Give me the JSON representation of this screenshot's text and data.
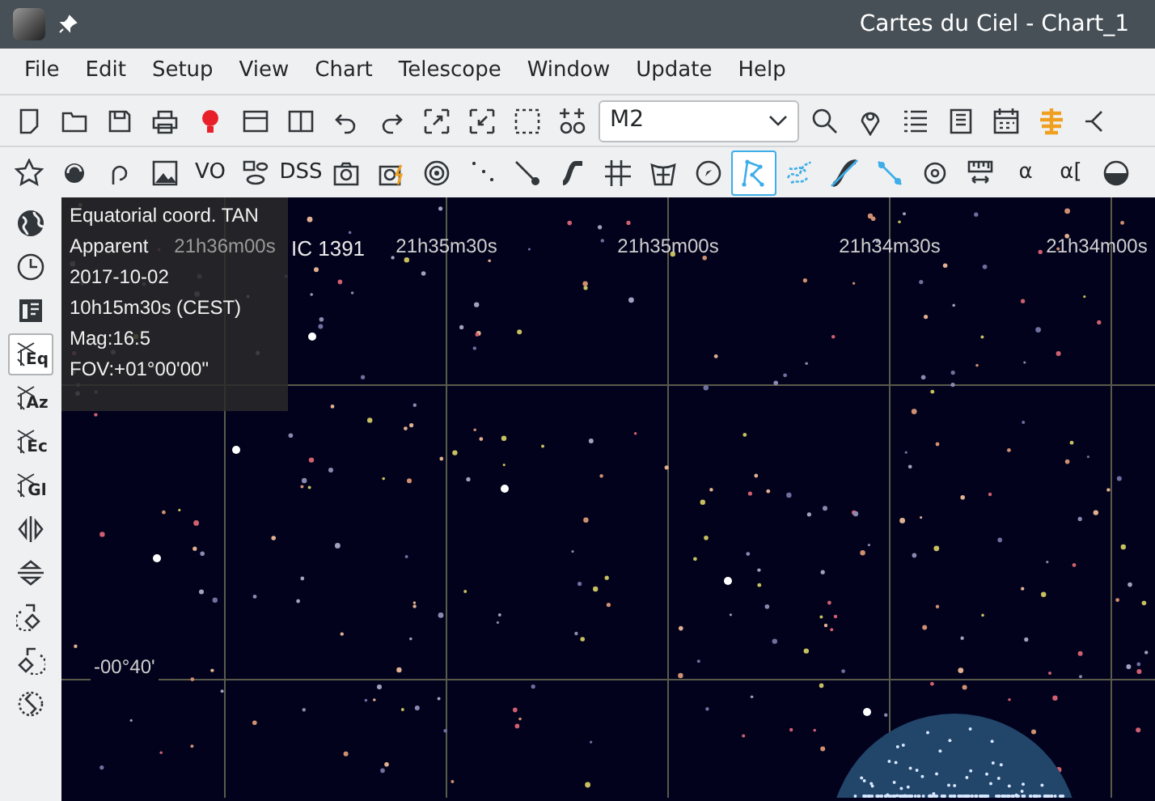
{
  "window": {
    "title": "Cartes du Ciel - Chart_1"
  },
  "menu": [
    {
      "label": "File"
    },
    {
      "label": "Edit"
    },
    {
      "label": "Setup"
    },
    {
      "label": "View"
    },
    {
      "label": "Chart"
    },
    {
      "label": "Telescope"
    },
    {
      "label": "Window"
    },
    {
      "label": "Update"
    },
    {
      "label": "Help"
    }
  ],
  "toolbar_1": [
    {
      "kind": "icon"
    },
    {
      "kind": "icon"
    },
    {
      "kind": "icon"
    },
    {
      "kind": "icon"
    },
    {
      "kind": "icon"
    },
    {
      "kind": "icon"
    },
    {
      "kind": "icon"
    },
    {
      "kind": "icon"
    },
    {
      "kind": "icon"
    },
    {
      "kind": "icon"
    },
    {
      "kind": "icon"
    },
    {
      "kind": "icon"
    },
    {
      "kind": "icon"
    },
    {
      "kind": "combo",
      "value": "M2"
    },
    {
      "kind": "icon"
    },
    {
      "kind": "icon"
    },
    {
      "kind": "icon"
    },
    {
      "kind": "icon"
    },
    {
      "kind": "icon"
    },
    {
      "kind": "icon"
    },
    {
      "kind": "icon"
    }
  ],
  "toolbar_2": [
    {
      "kind": "icon",
      "selected": false
    },
    {
      "kind": "icon",
      "selected": false
    },
    {
      "kind": "icon",
      "selected": false
    },
    {
      "kind": "icon",
      "selected": false
    },
    {
      "kind": "text",
      "label": "VO",
      "selected": false
    },
    {
      "kind": "icon",
      "selected": false
    },
    {
      "kind": "text",
      "label": "DSS",
      "selected": false
    },
    {
      "kind": "icon",
      "selected": false
    },
    {
      "kind": "icon",
      "selected": false
    },
    {
      "kind": "icon",
      "selected": false
    },
    {
      "kind": "icon",
      "selected": false
    },
    {
      "kind": "icon",
      "selected": false
    },
    {
      "kind": "icon",
      "selected": false
    },
    {
      "kind": "icon",
      "selected": false
    },
    {
      "kind": "icon",
      "selected": false
    },
    {
      "kind": "icon",
      "selected": false
    },
    {
      "kind": "icon",
      "selected": true
    },
    {
      "kind": "icon",
      "selected": false
    },
    {
      "kind": "icon",
      "selected": false
    },
    {
      "kind": "icon",
      "selected": false
    },
    {
      "kind": "icon",
      "selected": false
    },
    {
      "kind": "icon",
      "selected": false
    },
    {
      "kind": "text",
      "label": "α",
      "selected": false
    },
    {
      "kind": "text",
      "label": "α[",
      "selected": false
    },
    {
      "kind": "icon",
      "selected": false
    }
  ],
  "sidebar": [
    {
      "kind": "icon",
      "selected": false
    },
    {
      "kind": "icon",
      "selected": false
    },
    {
      "kind": "icon",
      "selected": false
    },
    {
      "kind": "grid",
      "label": "Eq",
      "selected": true
    },
    {
      "kind": "grid",
      "label": "Az",
      "selected": false
    },
    {
      "kind": "grid",
      "label": "Ec",
      "selected": false
    },
    {
      "kind": "grid",
      "label": "Gl",
      "selected": false
    },
    {
      "kind": "icon",
      "selected": false
    },
    {
      "kind": "icon",
      "selected": false
    },
    {
      "kind": "icon",
      "selected": false
    },
    {
      "kind": "icon",
      "selected": false
    },
    {
      "kind": "icon",
      "selected": false
    }
  ],
  "chart": {
    "ra_labels": [
      "21h36m00s",
      "21h35m30s",
      "21h35m00s",
      "21h34m30s",
      "21h34m00s"
    ],
    "object_label": "IC 1391",
    "dec_labels": [
      "-00°40'"
    ],
    "info": [
      "Equatorial coord. TAN",
      "Apparent",
      "2017-10-02",
      "10h15m30s (CEST)",
      "Mag:16.5",
      "FOV:+01°00'00\""
    ]
  }
}
